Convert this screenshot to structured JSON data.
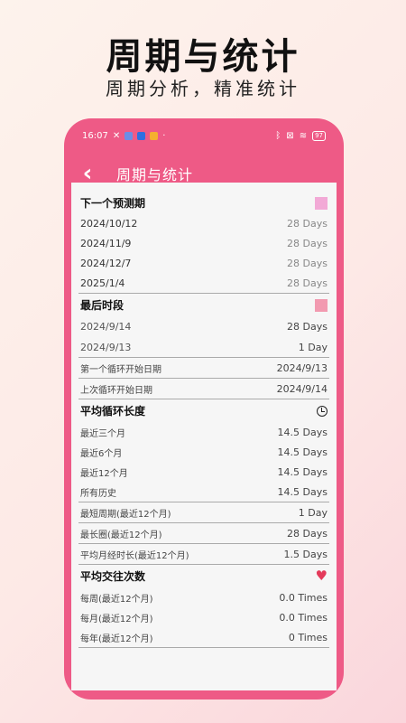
{
  "hero": {
    "title": "周期与统计",
    "subtitle": "周期分析，精准统计"
  },
  "status": {
    "time": "16:07",
    "battery": "97"
  },
  "appbar": {
    "title": "周期与统计",
    "back_icon": "‹"
  },
  "colors": {
    "pink": "#ee5a86",
    "predict_square": "#f2a9d6",
    "last_square": "#f29ab0",
    "heart": "#e43a5a"
  },
  "next_prediction": {
    "header": "下一个预测期",
    "rows": [
      {
        "date": "2024/10/12",
        "value": "28 Days"
      },
      {
        "date": "2024/11/9",
        "value": "28 Days"
      },
      {
        "date": "2024/12/7",
        "value": "28 Days"
      },
      {
        "date": "2025/1/4",
        "value": "28 Days"
      }
    ]
  },
  "last_period": {
    "header": "最后时段",
    "rows": [
      {
        "date": "2024/9/14",
        "value": "28 Days"
      },
      {
        "date": "2024/9/13",
        "value": "1 Day"
      }
    ],
    "first_cycle_label": "第一个循环开始日期",
    "first_cycle_value": "2024/9/13",
    "last_cycle_label": "上次循环开始日期",
    "last_cycle_value": "2024/9/14"
  },
  "avg_cycle": {
    "header": "平均循环长度",
    "rows": [
      {
        "label": "最近三个月",
        "value": "14.5 Days"
      },
      {
        "label": "最近6个月",
        "value": "14.5 Days"
      },
      {
        "label": "最近12个月",
        "value": "14.5 Days"
      },
      {
        "label": "所有历史",
        "value": "14.5 Days"
      }
    ],
    "shortest_label": "最短周期(最近12个月)",
    "shortest_value": "1 Day",
    "longest_label": "最长圈(最近12个月)",
    "longest_value": "28 Days",
    "avg_period_label": "平均月经时长(最近12个月)",
    "avg_period_value": "1.5 Days"
  },
  "intercourse": {
    "header": "平均交往次数",
    "rows": [
      {
        "label": "每周(最近12个月)",
        "value": "0.0 Times"
      },
      {
        "label": "每月(最近12个月)",
        "value": "0.0 Times"
      },
      {
        "label": "每年(最近12个月)",
        "value": "0 Times"
      }
    ]
  }
}
